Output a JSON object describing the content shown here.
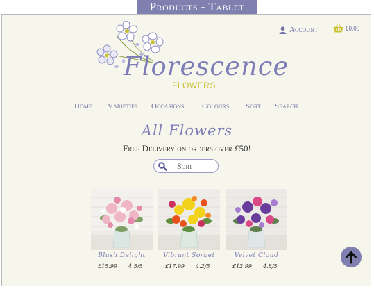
{
  "banner": "Products - Tablet",
  "header": {
    "account_label": "Account",
    "basket_total": "£0.00"
  },
  "logo": {
    "word": "Florescence",
    "sub": "FLOWERS"
  },
  "nav": [
    "Home",
    "Varieties",
    "Occasions",
    "Colours",
    "Sort",
    "Search"
  ],
  "page": {
    "title": "All Flowers",
    "delivery": "Free Delivery on orders over £50!",
    "sort_label": "Sort"
  },
  "products": [
    {
      "name": "Blush Delight",
      "price": "£15.99",
      "rating": "4.5/5"
    },
    {
      "name": "Vibrant Sorbet",
      "price": "£17.99",
      "rating": "4.2/5"
    },
    {
      "name": "Velvet Cloud",
      "price": "£12.99",
      "rating": "4.8/5"
    }
  ],
  "colors": {
    "accent": "#7f7fb0",
    "logo_sub": "#c9c236",
    "basket": "#c9c236",
    "background": "#f7f6ec"
  },
  "icons": [
    "user-icon",
    "basket-icon",
    "search-icon",
    "arrow-up-icon"
  ]
}
